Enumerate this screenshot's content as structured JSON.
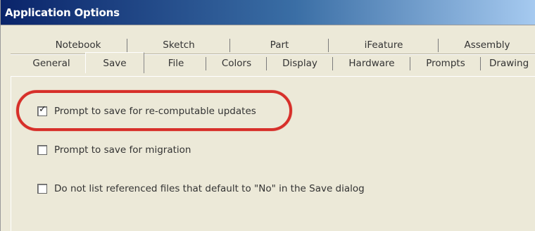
{
  "window": {
    "title": "Application Options"
  },
  "tabs": {
    "back_row": [
      "Notebook",
      "Sketch",
      "Part",
      "iFeature",
      "Assembly"
    ],
    "front_row": [
      "General",
      "Save",
      "File",
      "Colors",
      "Display",
      "Hardware",
      "Prompts",
      "Drawing"
    ],
    "selected": "Save"
  },
  "options": [
    {
      "label": "Prompt to save for re-computable updates",
      "checked": true
    },
    {
      "label": "Prompt to save for migration",
      "checked": false
    },
    {
      "label": "Do not list referenced files that default to \"No\" in the Save dialog",
      "checked": false
    }
  ],
  "colors": {
    "highlight": "#d7302a",
    "title_bar": "#0a246a"
  }
}
